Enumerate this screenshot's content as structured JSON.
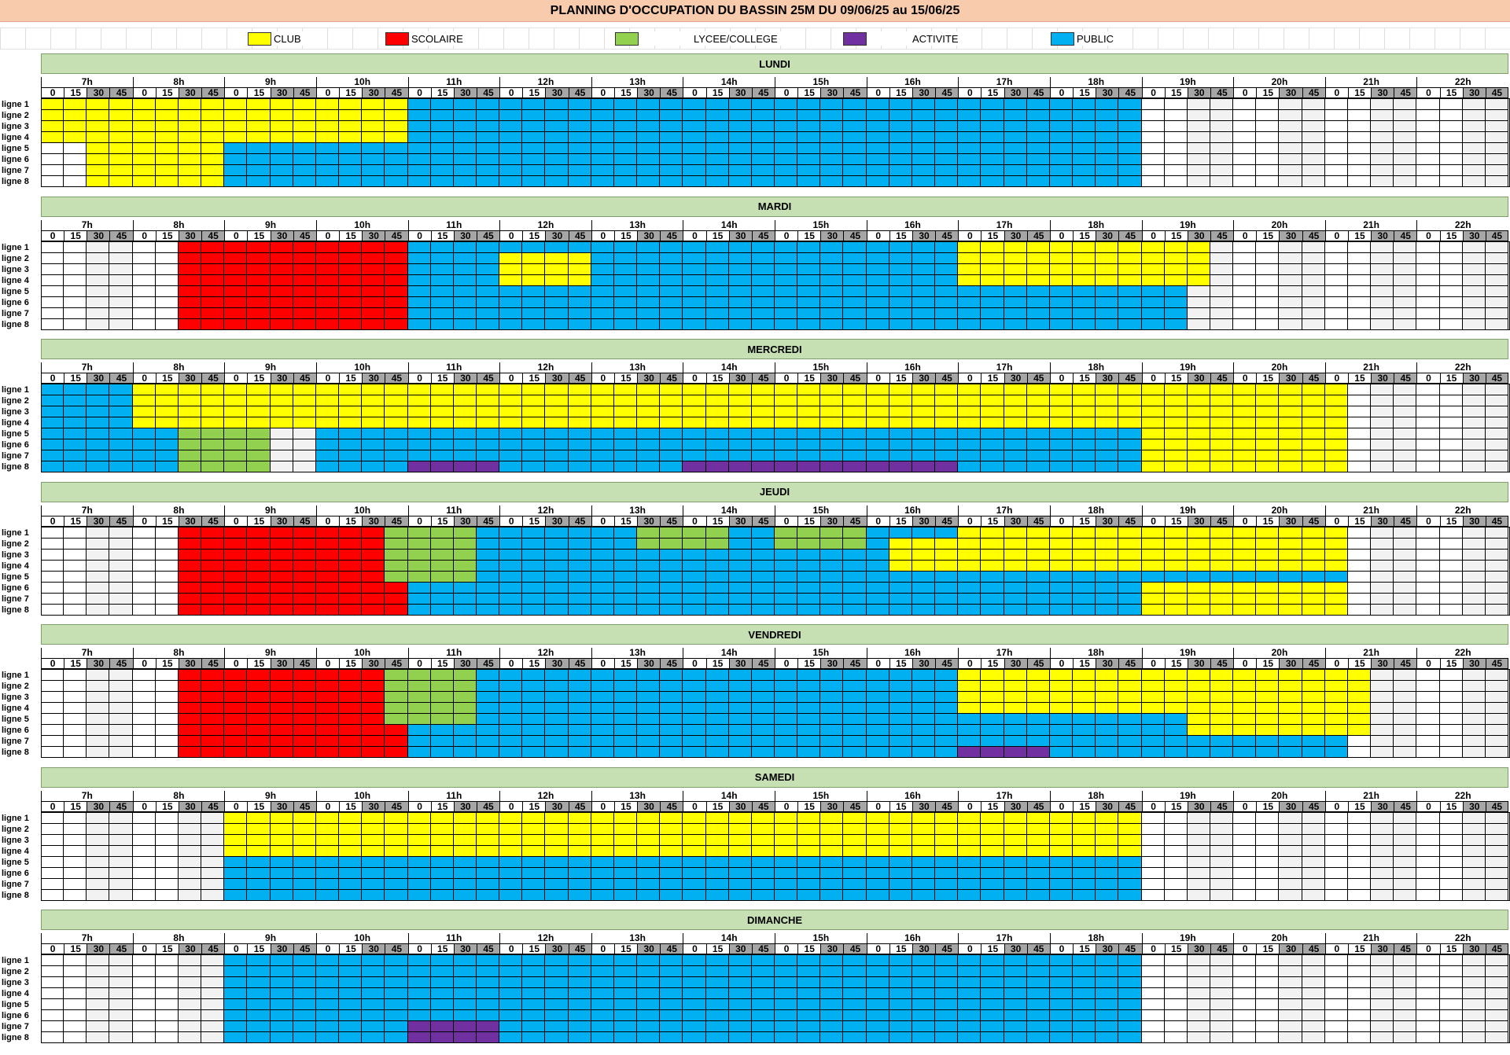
{
  "title": "PLANNING D'OCCUPATION DU BASSIN 25M DU 09/06/25 au 15/06/25",
  "legend": [
    {
      "key": "C",
      "label": "CLUB",
      "color": "#ffff00"
    },
    {
      "key": "S",
      "label": "SCOLAIRE",
      "color": "#ff0000"
    },
    {
      "key": "L",
      "label": "LYCEE/COLLEGE",
      "color": "#92d050"
    },
    {
      "key": "A",
      "label": "ACTIVITE",
      "color": "#7030a0"
    },
    {
      "key": "P",
      "label": "PUBLIC",
      "color": "#00b0f0"
    }
  ],
  "colors": {
    "empty": "#ffffff",
    "empty_alt": "#f2f2f2",
    "header": "#c6e0b4",
    "title_bg": "#f8cbad",
    "quarter_shade": "#a6a6a6"
  },
  "hours": [
    "7h",
    "8h",
    "9h",
    "10h",
    "11h",
    "12h",
    "13h",
    "14h",
    "15h",
    "16h",
    "17h",
    "18h",
    "19h",
    "20h",
    "21h",
    "22h"
  ],
  "quarters": [
    "0",
    "15",
    "30",
    "45"
  ],
  "lanes": [
    "ligne 1",
    "ligne 2",
    "ligne 3",
    "ligne 4",
    "ligne 5",
    "ligne 6",
    "ligne 7",
    "ligne 8"
  ],
  "days": [
    {
      "name": "LUNDI",
      "lanes": [
        "CCCCCCCCCCCCCCCCPPPPPPPPPPPPPPPPPPPPPPPPPPPPPPPP....................",
        "CCCCCCCCCCCCCCCCPPPPPPPPPPPPPPPPPPPPPPPPPPPPPPPP....................",
        "CCCCCCCCCCCCCCCCPPPPPPPPPPPPPPPPPPPPPPPPPPPPPPPP....................",
        "CCCCCCCCCCCCCCCCPPPPPPPPPPPPPPPPPPPPPPPPPPPPPPPP....................",
        "..CCCCCCPPPPPPPPPPPPPPPPPPPPPPPPPPPPPPPPPPPPPPPP....................",
        "..CCCCCCPPPPPPPPPPPPPPPPPPPPPPPPPPPPPPPPPPPPPPPP....................",
        "..CCCCCCPPPPPPPPPPPPPPPPPPPPPPPPPPPPPPPPPPPPPPPP....................",
        "..CCCCCCPPPPPPPPPPPPPPPPPPPPPPPPPPPPPPPPPPPPPPPP...................."
      ]
    },
    {
      "name": "MARDI",
      "lanes": [
        "......SSSSSSSSSSPPPPPPPPPPPPPPPPPPPPPPPPCCCCCCCCCCC.................",
        "......SSSSSSSSSSPPPPCCCCPPPPPPPPPPPPPPPPCCCCCCCCCCC.................",
        "......SSSSSSSSSSPPPPCCCCPPPPPPPPPPPPPPPPCCCCCCCCCCC.................",
        "......SSSSSSSSSSPPPPCCCCPPPPPPPPPPPPPPPPCCCCCCCCCCC.................",
        "......SSSSSSSSSSPPPPPPPPPPPPPPPPPPPPPPPPPPPPPPPPPP..................",
        "......SSSSSSSSSSPPPPPPPPPPPPPPPPPPPPPPPPPPPPPPPPPP..................",
        "......SSSSSSSSSSPPPPPPPPPPPPPPPPPPPPPPPPPPPPPPPPPP..................",
        "......SSSSSSSSSSPPPPPPPPPPPPPPPPPPPPPPPPPPPPPPPPPP.................."
      ]
    },
    {
      "name": "MERCREDI",
      "lanes": [
        "PPPPCCCCCCCCCCCCCCCCCCCCCCCCCCCCCCCCCCCCCCCCCCCCCCCCCCCCC...........",
        "PPPPCCCCCCCCCCCCCCCCCCCCCCCCCCCCCCCCCCCCCCCCCCCCCCCCCCCCC...........",
        "PPPPCCCCCCCCCCCCCCCCCCCCCCCCCCCCCCCCCCCCCCCCCCCCCCCCCCCCC...........",
        "PPPPCCCCCCCCCCCCCCCCCCCCCCCCCCCCCCCCCCCCCCCCCCCCCCCCCCCCC...........",
        "PPPPPPLLLL..PPPPPPPPPPPPPPPPPPPPPPPPPPPPPPPPPPPPCCCCCCCCC...........",
        "PPPPPPLLLL..PPPPPPPPPPPPPPPPPPPPPPPPPPPPPPPPPPPPCCCCCCCCC...........",
        "PPPPPPLLLL..PPPPPPPPPPPPPPPPPPPPPPPPPPPPPPPPPPPPCCCCCCCCC...........",
        "PPPPPPLLLL..PPPPAAAAPPPPPPPPAAAAAAAAAAAAPPPPPPPPCCCCCCCCC..........."
      ]
    },
    {
      "name": "JEUDI",
      "lanes": [
        "......SSSSSSSSSLLLLPPPPPPPLLLLPPLLLLPPPPCCCCCCCCCCCCCCCCC...........",
        "......SSSSSSSSSLLLLPPPPPPPLLLLPPLLLLPCCCCCCCCCCCCCCCCCCCC...........",
        "......SSSSSSSSSLLLLPPPPPPPPPPPPPPPPPPCCCCCCCCCCCCCCCCCCCC...........",
        "......SSSSSSSSSLLLLPPPPPPPPPPPPPPPPPPCCCCCCCCCCCCCCCCCCCC...........",
        "......SSSSSSSSSLLLLPPPPPPPPPPPPPPPPPPPPPPPPPPPPPPPPPPPPPP...........",
        "......SSSSSSSSSSPPPPPPPPPPPPPPPPPPPPPPPPPPPPPPPPCCCCCCCCC...........",
        "......SSSSSSSSSSPPPPPPPPPPPPPPPPPPPPPPPPPPPPPPPPCCCCCCCCC...........",
        "......SSSSSSSSSSPPPPPPPPPPPPPPPPPPPPPPPPPPPPPPPPCCCCCCCCC..........."
      ]
    },
    {
      "name": "VENDREDI",
      "lanes": [
        "......SSSSSSSSSLLLLPPPPPPPPPPPPPPPPPPPPPCCCCCCCCCCCCCCCCCC..........",
        "......SSSSSSSSSLLLLPPPPPPPPPPPPPPPPPPPPPCCCCCCCCCCCCCCCCCC..........",
        "......SSSSSSSSSLLLLPPPPPPPPPPPPPPPPPPPPPCCCCCCCCCCCCCCCCCC..........",
        "......SSSSSSSSSLLLLPPPPPPPPPPPPPPPPPPPPPCCCCCCCCCCCCCCCCCC..........",
        "......SSSSSSSSSLLLLPPPPPPPPPPPPPPPPPPPPPPPPPPPPPPPCCCCCCCC..........",
        "......SSSSSSSSSSPPPPPPPPPPPPPPPPPPPPPPPPPPPPPPPPPPCCCCCCCC..........",
        "......SSSSSSSSSSPPPPPPPPPPPPPPPPPPPPPPPPPPPPPPPPPPPPPPPPP...........",
        "......SSSSSSSSSSPPPPPPPPPPPPPPPPPPPPPPPPAAAAPPPPPPPPPPPPP..........."
      ]
    },
    {
      "name": "SAMEDI",
      "lanes": [
        "........CCCCCCCCCCCCCCCCCCCCCCCCCCCCCCCCCCCCCCCC....................",
        "........CCCCCCCCCCCCCCCCCCCCCCCCCCCCCCCCCCCCCCCC....................",
        "........CCCCCCCCCCCCCCCCCCCCCCCCCCCCCCCCCCCCCCCC....................",
        "........CCCCCCCCCCCCCCCCCCCCCCCCCCCCCCCCCCCCCCCC....................",
        "........PPPPPPPPPPPPPPPPPPPPPPPPPPPPPPPPPPPPPPPP....................",
        "........PPPPPPPPPPPPPPPPPPPPPPPPPPPPPPPPPPPPPPPP....................",
        "........PPPPPPPPPPPPPPPPPPPPPPPPPPPPPPPPPPPPPPPP....................",
        "........PPPPPPPPPPPPPPPPPPPPPPPPPPPPPPPPPPPPPPPP...................."
      ]
    },
    {
      "name": "DIMANCHE",
      "lanes": [
        "........PPPPPPPPPPPPPPPPPPPPPPPPPPPPPPPPPPPPPPPP....................",
        "........PPPPPPPPPPPPPPPPPPPPPPPPPPPPPPPPPPPPPPPP....................",
        "........PPPPPPPPPPPPPPPPPPPPPPPPPPPPPPPPPPPPPPPP....................",
        "........PPPPPPPPPPPPPPPPPPPPPPPPPPPPPPPPPPPPPPPP....................",
        "........PPPPPPPPPPPPPPPPPPPPPPPPPPPPPPPPPPPPPPPP....................",
        "........PPPPPPPPPPPPPPPPPPPPPPPPPPPPPPPPPPPPPPPP....................",
        "........PPPPPPPPAAAAPPPPPPPPPPPPPPPPPPPPPPPPPPPP....................",
        "........PPPPPPPPAAAAPPPPPPPPPPPPPPPPPPPPPPPPPPPP...................."
      ]
    }
  ]
}
